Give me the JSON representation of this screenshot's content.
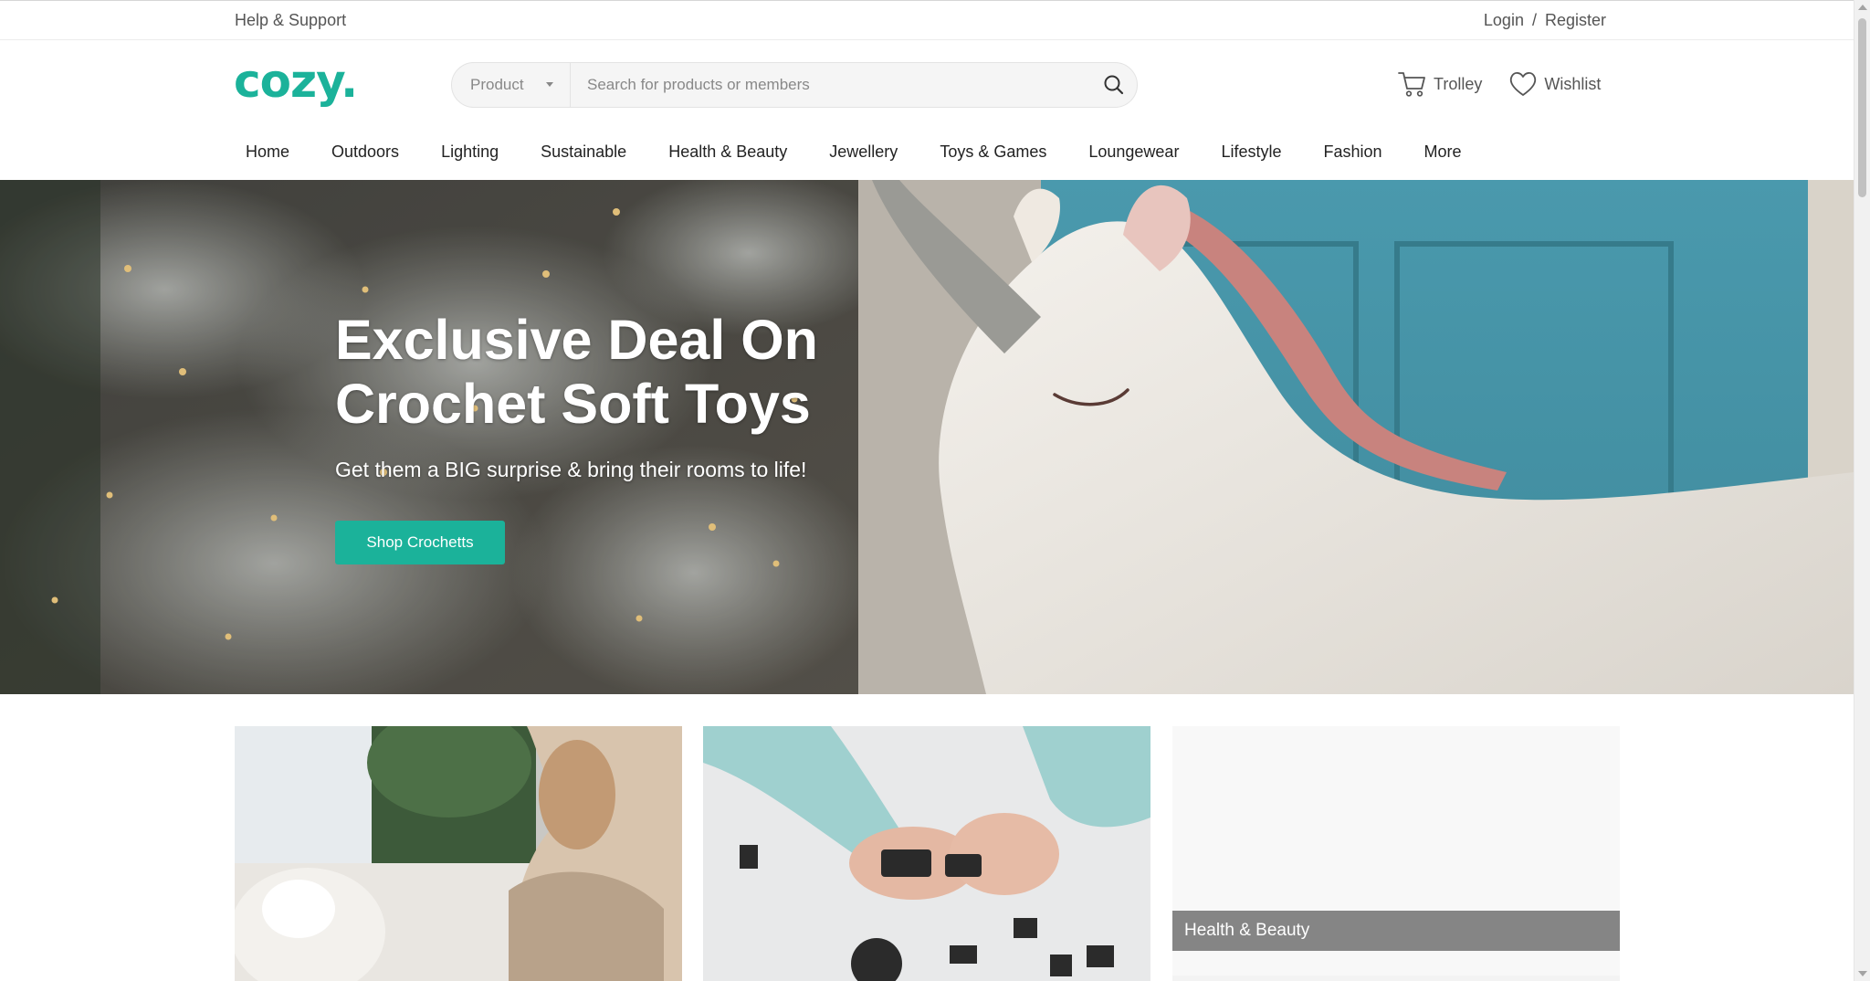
{
  "utility_bar": {
    "help": "Help & Support",
    "login": "Login",
    "separator": "/",
    "register": "Register"
  },
  "header": {
    "logo": "cozy.",
    "search": {
      "category": "Product",
      "placeholder": "Search for products or members"
    },
    "actions": {
      "trolley": "Trolley",
      "wishlist": "Wishlist"
    }
  },
  "nav": {
    "items": [
      "Home",
      "Outdoors",
      "Lighting",
      "Sustainable",
      "Health & Beauty",
      "Jewellery",
      "Toys & Games",
      "Loungewear",
      "Lifestyle",
      "Fashion",
      "More"
    ]
  },
  "hero": {
    "title_line1": "Exclusive Deal On",
    "title_line2": "Crochet Soft Toys",
    "subtitle": "Get them a BIG surprise & bring their rooms to life!",
    "cta": "Shop Crochetts"
  },
  "tiles": {
    "third_label": "Health & Beauty"
  },
  "colors": {
    "brand": "#1bb29a",
    "tile_label_bg": "#858585"
  }
}
